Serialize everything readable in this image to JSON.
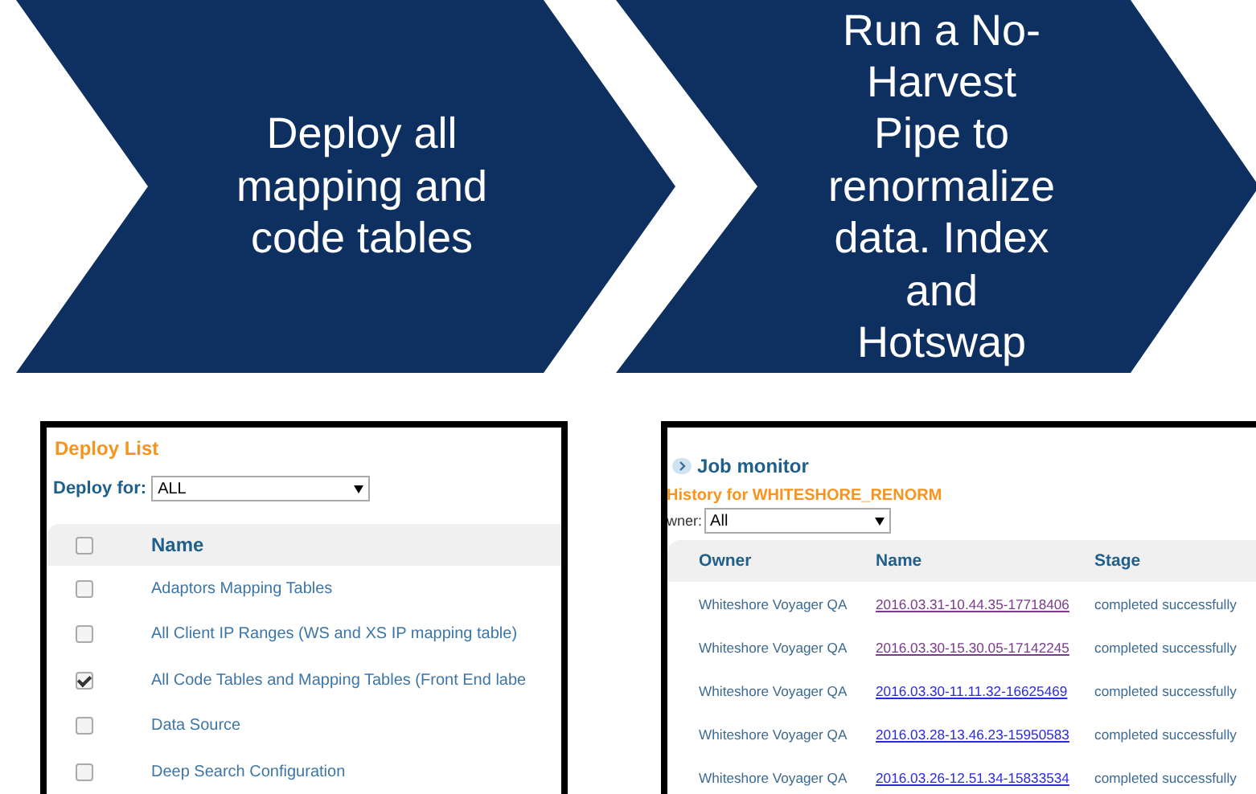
{
  "steps": [
    {
      "text": "Deploy all mapping and code tables"
    },
    {
      "text": "Run a No-Harvest Pipe to renormalize data. Index and Hotswap"
    }
  ],
  "deploy_list": {
    "title": "Deploy List",
    "filter_label": "Deploy for:",
    "filter_value": "ALL",
    "header_checked": false,
    "column": "Name",
    "rows": [
      {
        "name": "Adaptors Mapping Tables",
        "checked": false
      },
      {
        "name": "All Client IP Ranges (WS and XS IP mapping table)",
        "checked": false
      },
      {
        "name": "All Code Tables and Mapping Tables (Front End labe",
        "checked": true
      },
      {
        "name": "Data Source",
        "checked": false
      },
      {
        "name": "Deep Search Configuration",
        "checked": false
      }
    ]
  },
  "job_monitor": {
    "title": "Job monitor",
    "history_title": "History for WHITESHORE_RENORM",
    "filter_label": "wner:",
    "filter_value": "All",
    "columns": [
      "Owner",
      "Name",
      "Stage"
    ],
    "rows": [
      {
        "owner": "Whiteshore Voyager QA",
        "name": "2016.03.31-10.44.35-17718406",
        "visited": true,
        "stage": "completed successfully"
      },
      {
        "owner": "Whiteshore Voyager QA",
        "name": "2016.03.30-15.30.05-17142245",
        "visited": true,
        "stage": "completed successfully"
      },
      {
        "owner": "Whiteshore Voyager QA",
        "name": "2016.03.30-11.11.32-16625469",
        "visited": false,
        "stage": "completed successfully"
      },
      {
        "owner": "Whiteshore Voyager QA",
        "name": "2016.03.28-13.46.23-15950583",
        "visited": false,
        "stage": "completed successfully"
      },
      {
        "owner": "Whiteshore Voyager QA",
        "name": "2016.03.26-12.51.34-15833534",
        "visited": false,
        "stage": "completed successfully"
      }
    ]
  }
}
